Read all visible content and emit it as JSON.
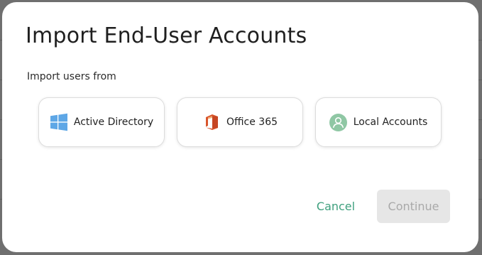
{
  "dialog": {
    "title": "Import End-User Accounts",
    "subtitle": "Import users from"
  },
  "sources": [
    {
      "label": "Active Directory",
      "icon": "windows-icon"
    },
    {
      "label": "Office 365",
      "icon": "office-365-icon"
    },
    {
      "label": "Local Accounts",
      "icon": "user-avatar-icon"
    }
  ],
  "actions": {
    "cancel_label": "Cancel",
    "continue_label": "Continue",
    "continue_disabled": true
  },
  "colors": {
    "accent": "#3fa07e",
    "windows_blue": "#5ea7e6",
    "office_orange": "#d9552b",
    "avatar_green": "#8fc7a4",
    "disabled_bg": "#e6e6e6",
    "disabled_text": "#a9a9a9"
  }
}
